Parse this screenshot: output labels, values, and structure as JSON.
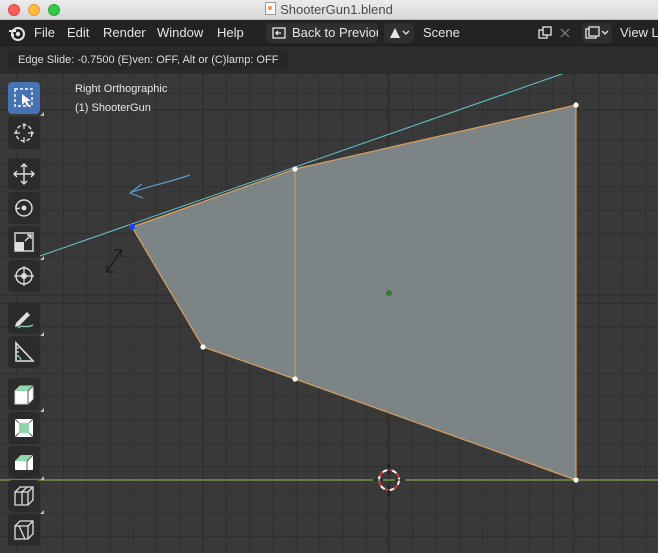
{
  "window": {
    "title": "ShooterGun1.blend"
  },
  "menu": {
    "items": [
      "File",
      "Edit",
      "Render",
      "Window",
      "Help"
    ],
    "back_button": "Back to Previou",
    "scene_label": "Scene",
    "view_layer_label": "View La"
  },
  "status": {
    "text": "Edge Slide: -0.7500 (E)ven: OFF, Alt or (C)lamp: OFF"
  },
  "viewport": {
    "view_name": "Right Orthographic",
    "object_name": "(1) ShooterGun"
  },
  "toolbar": {
    "tools": [
      "select-box",
      "cursor",
      "move",
      "rotate",
      "scale",
      "transform",
      "annotate",
      "measure",
      "extrude-region",
      "inset-faces",
      "bevel",
      "loop-cut",
      "knife"
    ],
    "active": "select-box"
  },
  "colors": {
    "mesh_face": "#7d8485",
    "mesh_edge": "#d9a15f",
    "selected_vertex": "#1b3cff",
    "guide_line": "#64c8d8",
    "x_axis": "#80a552",
    "annotation": "#5a9ecf"
  }
}
